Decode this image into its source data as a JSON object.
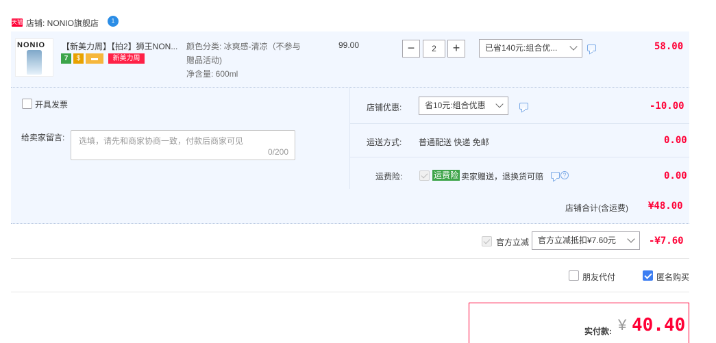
{
  "shop": {
    "badge": "天猫",
    "name": "店铺: NONIO旗舰店",
    "chat_badge": "1"
  },
  "item": {
    "thumb_brand": "NONIO",
    "title": "【新美力周】【拍2】狮王NON...",
    "tags": {
      "seven": "7",
      "guarantee": "$",
      "card": "▬",
      "promo": "新美力周"
    },
    "spec_line1": "颜色分类: 冰爽感-清凉（不参与",
    "spec_line2": "赠品活动)",
    "spec_line3": "净含量: 600ml",
    "unit_price": "99.00",
    "qty_minus": "−",
    "quantity": "2",
    "qty_plus": "+",
    "promo_select": "已省140元:组合优...",
    "subtotal": "58.00"
  },
  "order": {
    "invoice_label": "开具发票",
    "message_label": "给卖家留言:",
    "message_placeholder": "选填，请先和商家协商一致，付款后商家可见",
    "message_count": "0/200",
    "shop_discount_label": "店铺优惠:",
    "shop_discount_select": "省10元:组合优惠",
    "shop_discount_value": "-10.00",
    "shipping_label": "运送方式:",
    "shipping_text": "普通配送 快递 免邮",
    "shipping_value": "0.00",
    "insurance_label": "运费险:",
    "insurance_badge": "运费险",
    "insurance_text": "卖家赠送，退换货可赔",
    "insurance_value": "0.00",
    "shop_total_label": "店铺合计(含运费)",
    "shop_total_value": "¥48.00"
  },
  "official": {
    "checkbox_label": "官方立减",
    "select": "官方立减抵扣¥7.60元",
    "value": "-¥7.60"
  },
  "options": {
    "friend_pay_label": "朋友代付",
    "anonymous_label": "匿名购买"
  },
  "payment": {
    "label": "实付款:",
    "currency": "¥",
    "amount": "40.40"
  }
}
